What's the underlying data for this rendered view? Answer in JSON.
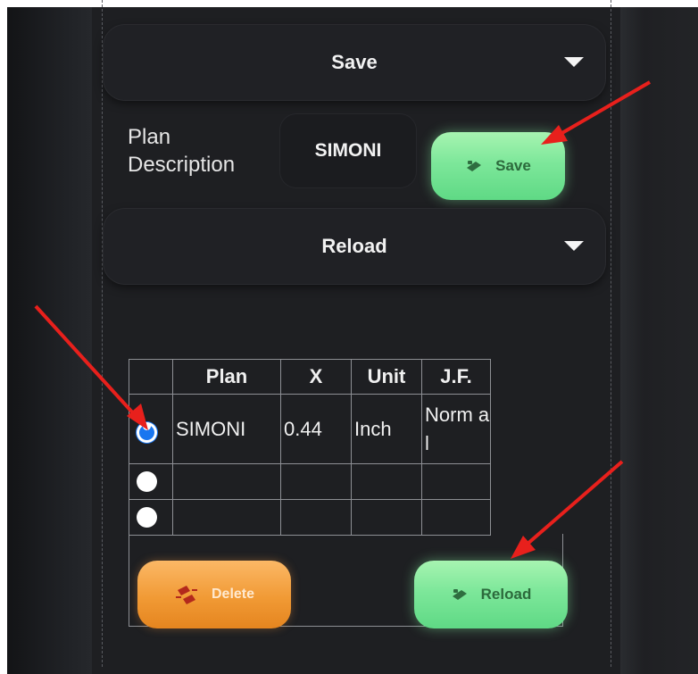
{
  "save_dropdown": {
    "label": "Save"
  },
  "plan_description": {
    "label": "Plan Description",
    "value": "SIMONI"
  },
  "save_button": {
    "label": "Save"
  },
  "reload_dropdown": {
    "label": "Reload"
  },
  "table": {
    "headers": [
      "Plan",
      "X",
      "Unit",
      "J.F."
    ],
    "rows": [
      {
        "selected": true,
        "plan": "SIMONI",
        "x": "0.44",
        "unit": "Inch",
        "jf": "Norm al"
      },
      {
        "selected": false,
        "plan": "",
        "x": "",
        "unit": "",
        "jf": ""
      },
      {
        "selected": false,
        "plan": "",
        "x": "",
        "unit": "",
        "jf": ""
      }
    ]
  },
  "delete_button": {
    "label": "Delete"
  },
  "reload_button": {
    "label": "Reload"
  },
  "colors": {
    "background": "#1c1d20",
    "green_button": "#7de79a",
    "orange_button": "#f19a35",
    "radio_selected": "#1976f0",
    "annotation_arrow": "#e8201c"
  },
  "icons": [
    "tag-icon",
    "delete-icon",
    "caret-down-icon",
    "arrow-annotation"
  ]
}
